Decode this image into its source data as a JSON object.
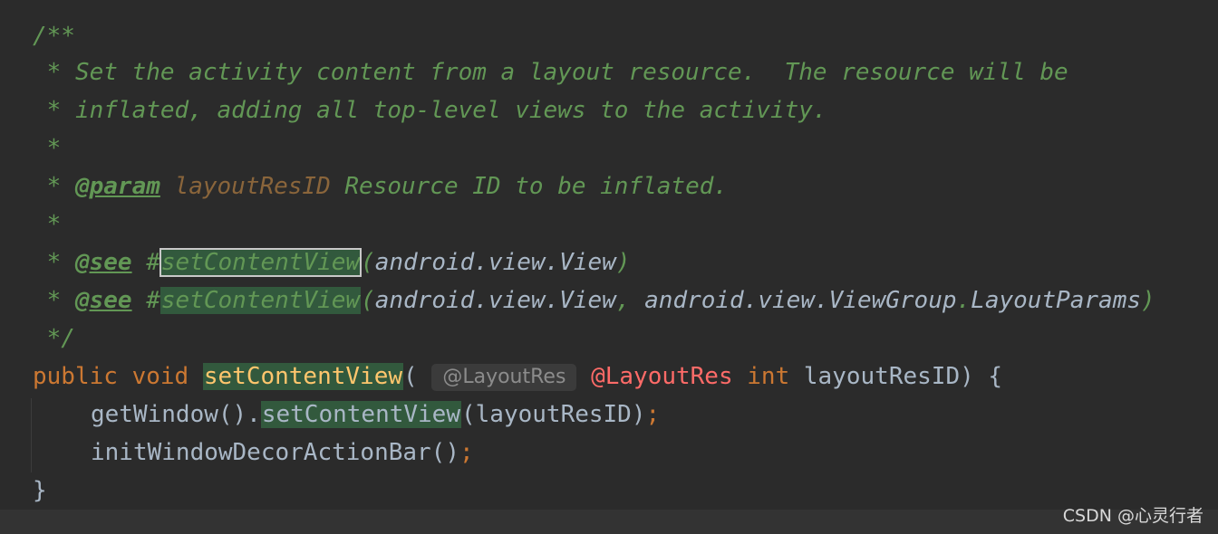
{
  "code": {
    "javadoc_open": "/**",
    "line1": " * Set the activity content from a layout resource.  The resource will be",
    "line2": " * inflated, adding all top-level views to the activity.",
    "blank_star": " *",
    "param_prefix": " * ",
    "param_tag": "@param",
    "param_name": "layoutResID",
    "param_desc": " Resource ID to be inflated.",
    "see_prefix": " * ",
    "see_tag": "@see",
    "hash": " #",
    "see1_method": "setContentView",
    "see1_args_open": "(",
    "see1_args": "android.view.View",
    "see1_args_close": ")",
    "see2_method": "setContentView",
    "see2_args_open": "(",
    "see2_arg_a": "android.view.View",
    "see2_comma": ", ",
    "see2_arg_b": "android.view.ViewGroup",
    "see2_dot": ".",
    "see2_arg_c": "LayoutParams",
    "see2_args_close": ")",
    "javadoc_close": " */",
    "kw_public": "public",
    "kw_void": "void",
    "method_name": "setContentView",
    "paren_open": "(",
    "inlay_hint": "@LayoutRes",
    "annotation": "@LayoutRes",
    "kw_int": "int",
    "param": "layoutResID",
    "sig_close": ") {",
    "call1_obj": "getWindow().",
    "call1_method": "setContentView",
    "call1_args": "(layoutResID)",
    "semicolon": ";",
    "call2": "initWindowDecorActionBar()",
    "close_brace": "}"
  },
  "watermark": "CSDN @心灵行者",
  "colors": {
    "background": "#2b2b2b",
    "comment": "#629755",
    "keyword": "#cc7832",
    "method_decl": "#ffc66d",
    "annotation": "#ff6b68",
    "usage_highlight": "#32593d",
    "param_name_doc": "#8a653b"
  }
}
